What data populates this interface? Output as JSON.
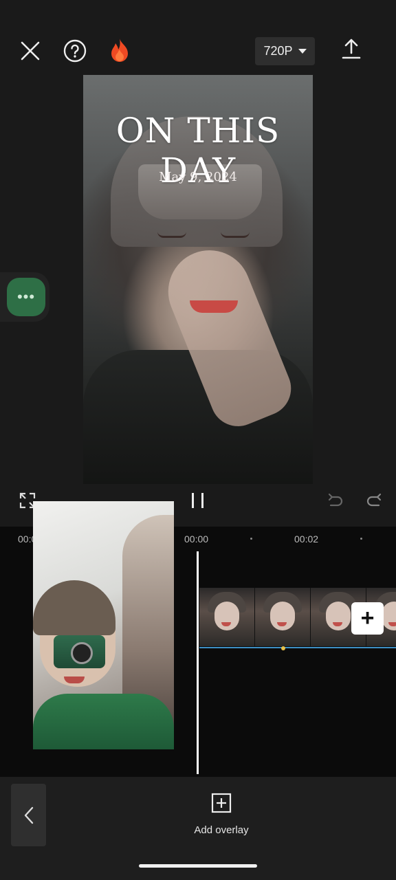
{
  "topbar": {
    "close_icon": "close-icon",
    "help_icon": "help-icon",
    "trending_icon": "fire-icon",
    "resolution": "720P",
    "export_icon": "upload-icon"
  },
  "preview": {
    "title": "ON THIS DAY",
    "date": "May 9, 2024"
  },
  "controls": {
    "fullscreen_icon": "fullscreen-icon",
    "pause_icon": "pause-icon",
    "undo_icon": "undo-icon",
    "redo_icon": "redo-icon"
  },
  "timeline": {
    "current_time": "00:00",
    "ruler_start": "00:00",
    "ruler_mark": "00:02",
    "add_clip_icon": "plus-icon"
  },
  "bottom": {
    "add_overlay_label": "Add overlay"
  },
  "colors": {
    "accent_green": "#2e6f46",
    "track_blue": "#3d8fc4"
  }
}
